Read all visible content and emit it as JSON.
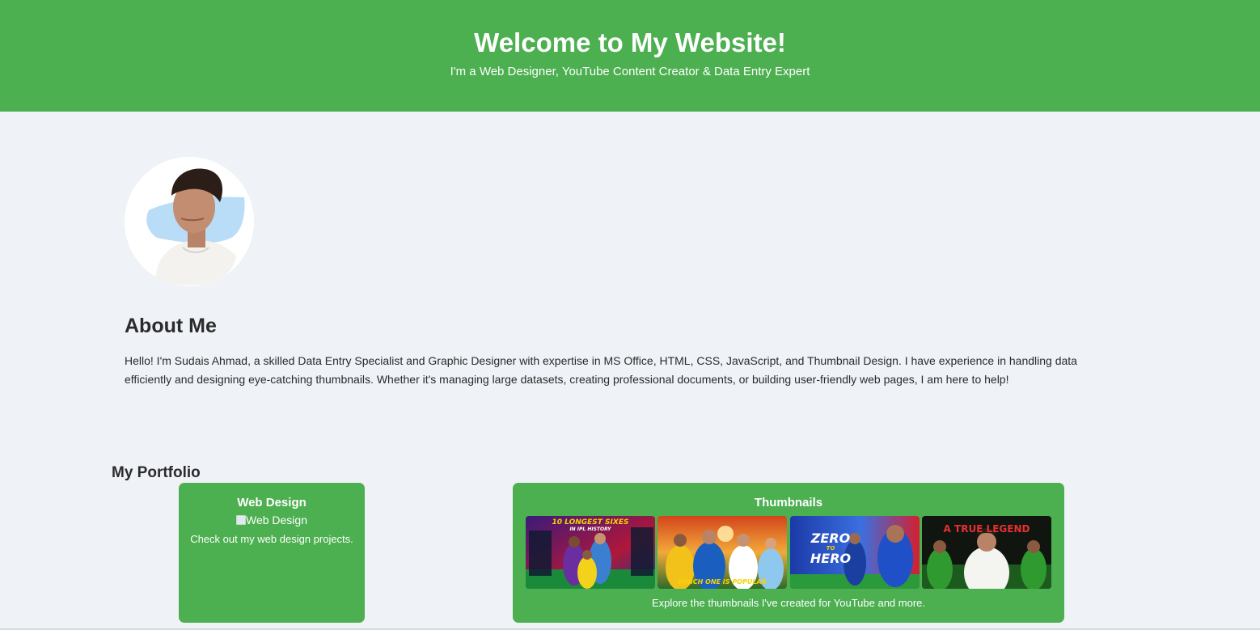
{
  "header": {
    "title": "Welcome to My Website!",
    "subtitle": "I'm a Web Designer, YouTube Content Creator & Data Entry Expert",
    "background_color": "#4caf50"
  },
  "profile": {
    "image": "profile-photo"
  },
  "about": {
    "title": "About Me",
    "text": "Hello! I'm Sudais Ahmad, a skilled Data Entry Specialist and Graphic Designer with expertise in MS Office, HTML, CSS, JavaScript, and Thumbnail Design. I have experience in handling data efficiently and designing eye-catching thumbnails. Whether it's managing large datasets, creating professional documents, or building user-friendly web pages, I am here to help!"
  },
  "portfolio": {
    "title": "My Portfolio",
    "cards": [
      {
        "title": "Web Design",
        "image_alt": "Web Design",
        "description": "Check out my web design projects."
      },
      {
        "title": "Thumbnails",
        "description": "Explore the thumbnails I've created for YouTube and more.",
        "thumbnails": [
          {
            "text_top": "10 LONGEST SIXES",
            "text_sub": "IN IPL HISTORY"
          },
          {
            "text_top": "WHICH ONE IS POPULAR"
          },
          {
            "text_top": "ZERO",
            "text_mid": "TO",
            "text_bottom": "HERO"
          },
          {
            "text_top": "A TRUE LEGEND"
          }
        ]
      }
    ]
  },
  "colors": {
    "accent": "#4caf50",
    "page_background": "#eff2f7",
    "text": "#2b2b2b"
  }
}
